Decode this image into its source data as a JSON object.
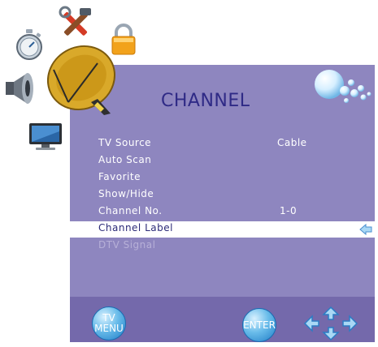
{
  "menu": {
    "title": "CHANNEL",
    "items": [
      {
        "label": "TV Source",
        "value": "Cable",
        "state": "normal"
      },
      {
        "label": "Auto Scan",
        "value": "",
        "state": "normal"
      },
      {
        "label": "Favorite",
        "value": "",
        "state": "normal"
      },
      {
        "label": "Show/Hide",
        "value": "",
        "state": "normal"
      },
      {
        "label": "Channel No.",
        "value": "1-0",
        "state": "normal"
      },
      {
        "label": "Channel Label",
        "value": "",
        "state": "selected"
      },
      {
        "label": "DTV Signal",
        "value": "",
        "state": "disabled"
      }
    ]
  },
  "footer": {
    "tv_menu_line1": "TV",
    "tv_menu_line2": "MENU",
    "enter_label": "ENTER"
  },
  "icons": {
    "categories": [
      "stopwatch-icon",
      "tools-icon",
      "lock-icon",
      "speaker-icon",
      "satellite-dish-icon",
      "monitor-icon"
    ],
    "header_decoration": "bubbles-icon",
    "navigation": "arrow-pad-icon"
  },
  "colors": {
    "panel": "#8e86bf",
    "footer": "#7469ab",
    "title": "#2f2a86",
    "selected_row": "#ffffff",
    "disabled_text": "#b7b0d8"
  }
}
